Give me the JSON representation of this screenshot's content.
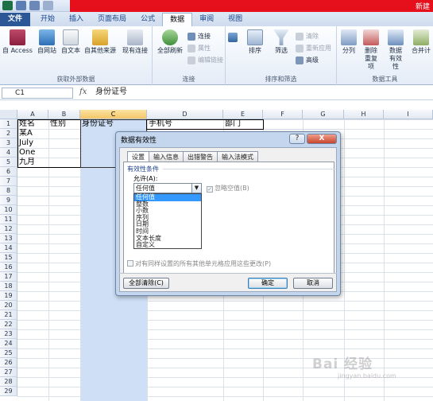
{
  "window": {
    "title": "新建"
  },
  "tabs": [
    "文件",
    "开始",
    "插入",
    "页面布局",
    "公式",
    "数据",
    "审阅",
    "视图"
  ],
  "active_tab": "数据",
  "ribbon": {
    "external_data": {
      "access": "自 Access",
      "web": "自网站",
      "text": "自文本",
      "other": "自其他来源",
      "existing": "现有连接",
      "label": "获取外部数据"
    },
    "connections": {
      "refresh": "全部刷新",
      "conn": "连接",
      "props": "属性",
      "edit_links": "编辑链接",
      "label": "连接"
    },
    "sort_filter": {
      "sort": "排序",
      "filter": "筛选",
      "clear": "清除",
      "reapply": "重新应用",
      "advanced": "高级",
      "label": "排序和筛选"
    },
    "data_tools": {
      "split": "分列",
      "remove_dup": "删除重复项",
      "validation": "数据有效性",
      "consolidate": "合并计",
      "label": "数据工具"
    }
  },
  "formula_bar": {
    "name_box": "C1",
    "fx": "fx",
    "content": "身份证号"
  },
  "columns": [
    "A",
    "B",
    "C",
    "D",
    "E",
    "F",
    "G",
    "H",
    "I"
  ],
  "rows": [
    "1",
    "2",
    "3",
    "4",
    "5",
    "6",
    "7",
    "8",
    "9",
    "10",
    "11",
    "12",
    "13",
    "14",
    "15",
    "16",
    "17",
    "18",
    "19",
    "20",
    "21",
    "22",
    "23",
    "24",
    "25",
    "26",
    "27",
    "28",
    "29"
  ],
  "cells": {
    "a1": "姓名",
    "b1": "性别",
    "c1": "身份证号",
    "d1": "手机号",
    "e1": "部门",
    "a2": "某A",
    "a3": "July",
    "a4": "One",
    "a5": "九月"
  },
  "dialog": {
    "title": "数据有效性",
    "help": "?",
    "close": "X",
    "tabs": [
      "设置",
      "输入信息",
      "出错警告",
      "输入法模式"
    ],
    "criteria_label": "有效性条件",
    "allow_label": "允许(A):",
    "allow_value": "任何值",
    "ignore_blank": "忽略空值(B)",
    "options": [
      "任何值",
      "整数",
      "小数",
      "序列",
      "日期",
      "时间",
      "文本长度",
      "自定义"
    ],
    "apply_all": "对有同样设置的所有其他单元格应用这些更改(P)",
    "clear_all": "全部清除(C)",
    "ok": "确定",
    "cancel": "取消"
  },
  "watermark": {
    "main": "Bai 经验",
    "sub": "jingyan.baidu.com"
  },
  "colors": {
    "accent": "#2b5797",
    "title_red": "#e6101c",
    "selection": "#cfe0f6",
    "highlight": "#3399ff"
  }
}
